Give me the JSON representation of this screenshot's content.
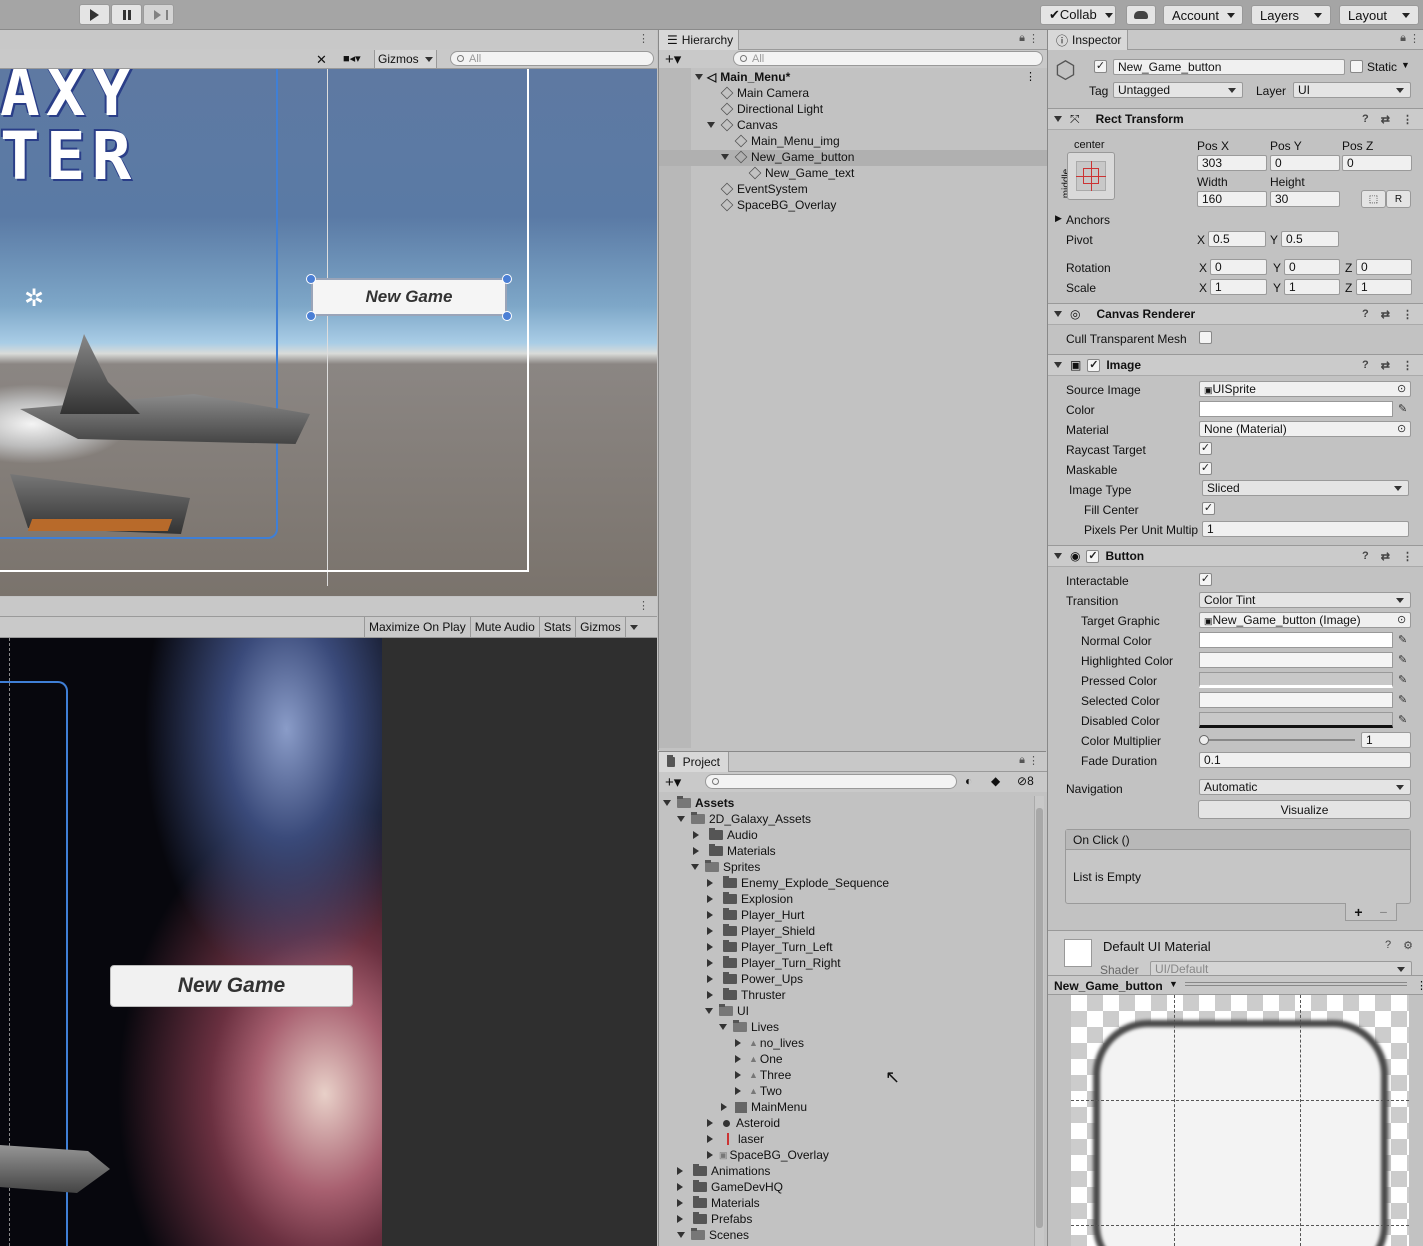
{
  "toolbar": {
    "collab": "Collab",
    "account": "Account",
    "layers": "Layers",
    "layout": "Layout"
  },
  "scene": {
    "gizmos": "Gizmos",
    "search_placeholder": "All",
    "logo_line1": "AXY",
    "logo_line2": "TER",
    "button_text": "New Game"
  },
  "game": {
    "maximize": "Maximize On Play",
    "mute": "Mute Audio",
    "stats": "Stats",
    "gizmos": "Gizmos",
    "button_text": "New Game"
  },
  "hierarchy": {
    "tab": "Hierarchy",
    "search_placeholder": "All",
    "items": [
      "Main_Menu*",
      "Main Camera",
      "Directional Light",
      "Canvas",
      "Main_Menu_img",
      "New_Game_button",
      "New_Game_text",
      "EventSystem",
      "SpaceBG_Overlay"
    ]
  },
  "project": {
    "tab": "Project",
    "badge": "8",
    "items": [
      "Assets",
      "2D_Galaxy_Assets",
      "Audio",
      "Materials",
      "Sprites",
      "Enemy_Explode_Sequence",
      "Explosion",
      "Player_Hurt",
      "Player_Shield",
      "Player_Turn_Left",
      "Player_Turn_Right",
      "Power_Ups",
      "Thruster",
      "UI",
      "Lives",
      "no_lives",
      "One",
      "Three",
      "Two",
      "MainMenu",
      "Asteroid",
      "laser",
      "SpaceBG_Overlay",
      "Animations",
      "GameDevHQ",
      "Materials",
      "Prefabs",
      "Scenes"
    ]
  },
  "inspector": {
    "tab": "Inspector",
    "object_name": "New_Game_button",
    "static": "Static",
    "tag_label": "Tag",
    "tag_value": "Untagged",
    "layer_label": "Layer",
    "layer_value": "UI",
    "rect": {
      "title": "Rect Transform",
      "anchor_h": "center",
      "anchor_v": "middle",
      "posx_label": "Pos X",
      "posx": "303",
      "posy_label": "Pos Y",
      "posy": "0",
      "posz_label": "Pos Z",
      "posz": "0",
      "width_label": "Width",
      "width": "160",
      "height_label": "Height",
      "height": "30",
      "r_btn": "R",
      "anchors": "Anchors",
      "pivot": "Pivot",
      "pivot_x": "0.5",
      "pivot_y": "0.5",
      "rotation": "Rotation",
      "rot_x": "0",
      "rot_y": "0",
      "rot_z": "0",
      "scale": "Scale",
      "scale_x": "1",
      "scale_y": "1",
      "scale_z": "1",
      "x": "X",
      "y": "Y",
      "z": "Z"
    },
    "canvas_renderer": {
      "title": "Canvas Renderer",
      "cull": "Cull Transparent Mesh"
    },
    "image": {
      "title": "Image",
      "source_image_label": "Source Image",
      "source_image": "UISprite",
      "color_label": "Color",
      "material_label": "Material",
      "material": "None (Material)",
      "raycast": "Raycast Target",
      "maskable": "Maskable",
      "image_type_label": "Image Type",
      "image_type": "Sliced",
      "fill_center": "Fill Center",
      "ppu_label": "Pixels Per Unit Multip",
      "ppu": "1"
    },
    "button": {
      "title": "Button",
      "interactable": "Interactable",
      "transition_label": "Transition",
      "transition": "Color Tint",
      "target_graphic_label": "Target Graphic",
      "target_graphic": "New_Game_button (Image)",
      "normal": "Normal Color",
      "highlighted": "Highlighted Color",
      "pressed": "Pressed Color",
      "selected": "Selected Color",
      "disabled": "Disabled Color",
      "multiplier_label": "Color Multiplier",
      "multiplier": "1",
      "fade_label": "Fade Duration",
      "fade": "0.1",
      "navigation_label": "Navigation",
      "navigation": "Automatic",
      "visualize": "Visualize",
      "onclick": "On Click ()",
      "list_empty": "List is Empty"
    },
    "material": {
      "name": "Default UI Material",
      "shader_label": "Shader",
      "shader": "UI/Default"
    },
    "preview": {
      "title": "New_Game_button"
    }
  }
}
